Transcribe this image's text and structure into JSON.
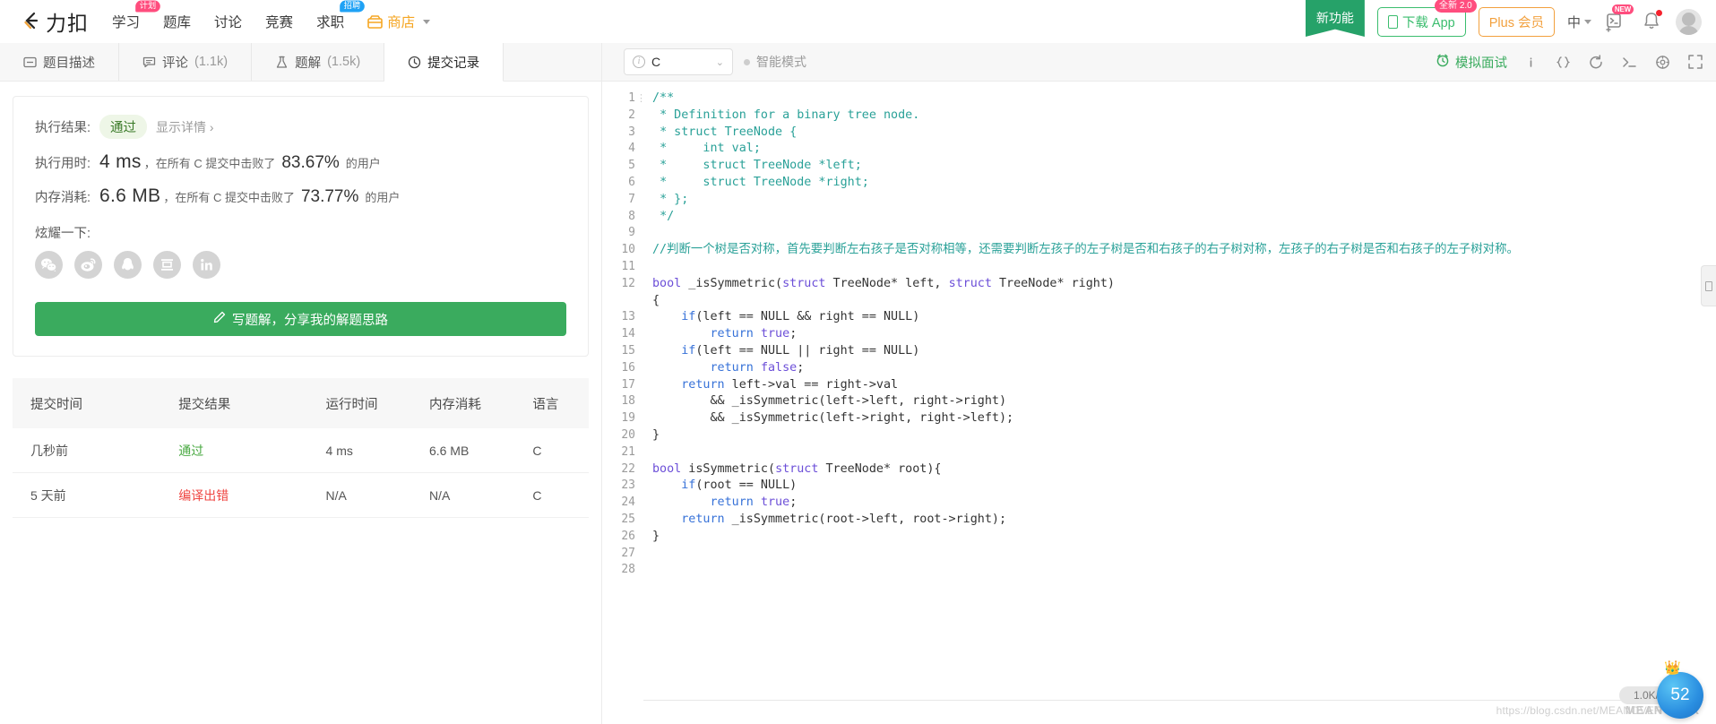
{
  "nav": {
    "logo_text": "力扣",
    "items": [
      {
        "label": "学习",
        "badge": "计划",
        "badge_color": "pink"
      },
      {
        "label": "题库",
        "badge": "",
        "badge_color": ""
      },
      {
        "label": "讨论",
        "badge": "",
        "badge_color": ""
      },
      {
        "label": "竞赛",
        "badge": "",
        "badge_color": ""
      },
      {
        "label": "求职",
        "badge": "招聘",
        "badge_color": "blue"
      }
    ],
    "shop_label": "商店",
    "new_feature_ribbon": "新功能",
    "download_app": "下载 App",
    "download_app_badge": "全新 2.0",
    "plus_member": "Plus 会员",
    "lang_current": "中",
    "terminal_badge": "NEW"
  },
  "tabs": [
    {
      "label": "题目描述",
      "count": "",
      "icon": "description-icon",
      "active": false
    },
    {
      "label": "评论",
      "count": "(1.1k)",
      "icon": "comment-icon",
      "active": false
    },
    {
      "label": "题解",
      "count": "(1.5k)",
      "icon": "flask-icon",
      "active": false
    },
    {
      "label": "提交记录",
      "count": "",
      "icon": "clock-icon",
      "active": true
    }
  ],
  "result": {
    "result_label": "执行结果:",
    "status": "通过",
    "detail_link": "显示详情 ›",
    "runtime_label": "执行用时:",
    "runtime_value": "4 ms",
    "runtime_mid": "，在所有 C 提交中击败了",
    "runtime_pct": "83.67%",
    "runtime_suffix": "的用户",
    "memory_label": "内存消耗:",
    "memory_value": "6.6 MB",
    "memory_mid": "，在所有 C 提交中击败了",
    "memory_pct": "73.77%",
    "memory_suffix": "的用户",
    "share_label": "炫耀一下:",
    "share_icons": [
      "wechat-icon",
      "weibo-icon",
      "qq-icon",
      "douban-icon",
      "linkedin-icon"
    ],
    "write_button": "写题解，分享我的解题思路"
  },
  "submissions": {
    "headers": [
      "提交时间",
      "提交结果",
      "运行时间",
      "内存消耗",
      "语言"
    ],
    "rows": [
      {
        "time": "几秒前",
        "status": "通过",
        "status_type": "pass",
        "runtime": "4 ms",
        "memory": "6.6 MB",
        "lang": "C"
      },
      {
        "time": "5 天前",
        "status": "编译出错",
        "status_type": "error",
        "runtime": "N/A",
        "memory": "N/A",
        "lang": "C"
      }
    ]
  },
  "editor": {
    "language": "C",
    "smart_mode": "智能模式",
    "mock_interview": "模拟面试",
    "code_lines": [
      {
        "n": 1,
        "html": "<span class='cmt'>/**</span>"
      },
      {
        "n": 2,
        "html": "<span class='cmt'> * Definition for a binary tree node.</span>"
      },
      {
        "n": 3,
        "html": "<span class='cmt'> * struct TreeNode {</span>"
      },
      {
        "n": 4,
        "html": "<span class='cmt'> *     int val;</span>"
      },
      {
        "n": 5,
        "html": "<span class='cmt'> *     struct TreeNode *left;</span>"
      },
      {
        "n": 6,
        "html": "<span class='cmt'> *     struct TreeNode *right;</span>"
      },
      {
        "n": 7,
        "html": "<span class='cmt'> * };</span>"
      },
      {
        "n": 8,
        "html": "<span class='cmt'> */</span>"
      },
      {
        "n": 9,
        "html": ""
      },
      {
        "n": 10,
        "html": "<span class='cmt'>//判断一个树是否对称，首先要判断左右孩子是否对称相等，还需要判断左孩子的左子树是否和右孩子的右子树对称，左孩子的右子树是否和右孩子的左子树对称。</span>"
      },
      {
        "n": 11,
        "html": ""
      },
      {
        "n": 12,
        "html": "<span class='kw'>bool</span> _isSymmetric(<span class='kw'>struct</span> TreeNode* left, <span class='kw'>struct</span> TreeNode* right)"
      },
      {
        "n": 13,
        "html": "{"
      },
      {
        "n": 14,
        "html": "    <span class='kw2'>if</span>(left == NULL &amp;&amp; right == NULL)"
      },
      {
        "n": 15,
        "html": "        <span class='kw2'>return</span> <span class='kw'>true</span>;"
      },
      {
        "n": 16,
        "html": "    <span class='kw2'>if</span>(left == NULL || right == NULL)"
      },
      {
        "n": 17,
        "html": "        <span class='kw2'>return</span> <span class='kw'>false</span>;"
      },
      {
        "n": 18,
        "html": "    <span class='kw2'>return</span> left-&gt;val == right-&gt;val"
      },
      {
        "n": 19,
        "html": "        &amp;&amp; _isSymmetric(left-&gt;left, right-&gt;right)"
      },
      {
        "n": 20,
        "html": "        &amp;&amp; _isSymmetric(left-&gt;right, right-&gt;left);"
      },
      {
        "n": 21,
        "html": "}"
      },
      {
        "n": 22,
        "html": ""
      },
      {
        "n": 23,
        "html": "<span class='kw'>bool</span> isSymmetric(<span class='kw'>struct</span> TreeNode* root){"
      },
      {
        "n": 24,
        "html": "    <span class='kw2'>if</span>(root == NULL)"
      },
      {
        "n": 25,
        "html": "        <span class='kw2'>return</span> <span class='kw'>true</span>;"
      },
      {
        "n": 26,
        "html": "    <span class='kw2'>return</span> _isSymmetric(root-&gt;left, root-&gt;right);"
      },
      {
        "n": 27,
        "html": "}"
      },
      {
        "n": 28,
        "html": ""
      }
    ]
  },
  "floating": {
    "speed": "1.0K/s",
    "badge_count": "52",
    "watermark": "https://blog.csdn.net/MEANOVER",
    "watermark2": "MEANOVER"
  }
}
